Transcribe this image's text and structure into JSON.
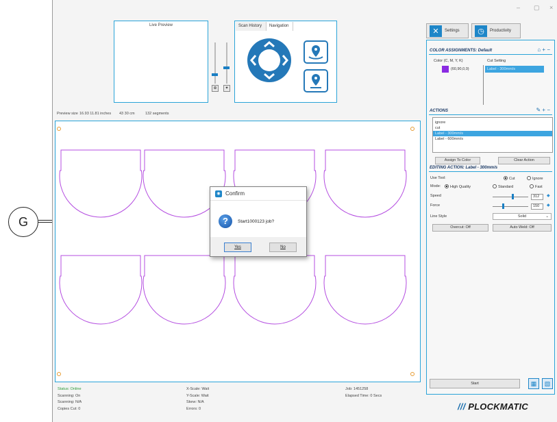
{
  "callout": {
    "label": "G"
  },
  "window": {
    "minimize": "–",
    "maximize": "▢",
    "close": "×"
  },
  "preview": {
    "title": "Live Preview"
  },
  "navigation": {
    "tabs": [
      "Scan History",
      "Navigation"
    ]
  },
  "preview_info": {
    "size_label": "Preview size",
    "inches": "16.93  11.81 inches",
    "cm": "43  30 cm",
    "segments": "132 segments"
  },
  "toolbar": {
    "settings_label": "Settings",
    "productivity_label": "Productivity"
  },
  "color_assignments": {
    "heading": "COLOR ASSIGNMENTS: Default",
    "col_color": "Color (C, M, Y, K)",
    "col_cut": "Cut Setting",
    "color_value": "(60,90,0,0)",
    "swatch": "#8a2be2",
    "cut_value": "Label - 300mm/s"
  },
  "actions": {
    "heading": "ACTIONS",
    "items": [
      "ignore",
      "cut",
      "Label - 300mm/s",
      "Label - 600mm/s"
    ],
    "selected_index": 2,
    "assign_label": "Assign To Color",
    "clear_label": "Clear Action"
  },
  "editing": {
    "heading": "EDITING ACTION: Label - 300mm/s",
    "use_tool_label": "Use Tool:",
    "use_tool_options": [
      "Cut",
      "Ignore"
    ],
    "mode_label": "Mode:",
    "mode_options": [
      "High Quality",
      "Standard",
      "Fast"
    ],
    "speed_label": "Speed",
    "speed_value": "312",
    "force_label": "Force",
    "force_value": "150",
    "line_style_label": "Line Style",
    "line_style_value": "Solid",
    "overcut_label": "Overcut: Off",
    "autoweld_label": "Auto Weld: Off"
  },
  "start": {
    "label": "Start"
  },
  "status": {
    "col1": [
      "Status: Online",
      "Scanning: On",
      "Scanning: N/A",
      "Copies Cut: 0"
    ],
    "col2": [
      "X-Scale: Wait",
      "Y-Scale: Wait",
      "Skew: N/A",
      "Errors: 0"
    ],
    "col3": [
      "Job: 1451258",
      "Elapsed Time: 0 Secs"
    ]
  },
  "logo": {
    "slashes": "///",
    "text": "PLOCKMATIC"
  },
  "dialog": {
    "title": "Confirm",
    "message": "Start1000123 job?",
    "yes_label": "Yes",
    "no_label": "No"
  },
  "colors": {
    "accent": "#29a3d8",
    "cut_line": "#b44de0",
    "registration": "#e69a30"
  }
}
